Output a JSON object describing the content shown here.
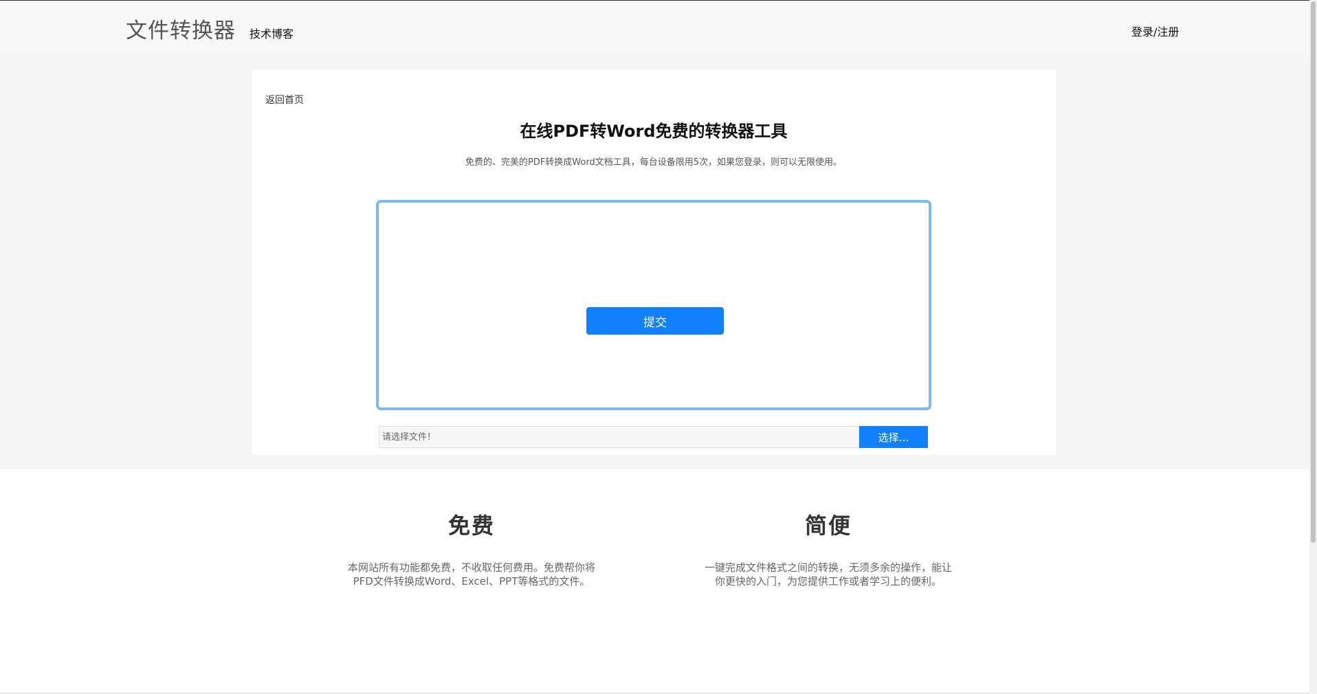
{
  "header": {
    "logo": "文件转换器",
    "nav_blog": "技术博客",
    "login": "登录/注册"
  },
  "converter": {
    "back_link": "返回首页",
    "title": "在线PDF转Word免费的转换器工具",
    "subtitle": "免费的、完美的PDF转换成Word文档工具，每台设备限用5次，如果您登录，则可以无限使用。",
    "submit_label": "提交",
    "file_placeholder": "请选择文件！",
    "choose_label": "选择…"
  },
  "features": [
    {
      "title": "免费",
      "desc": "本网站所有功能都免费，不收取任何费用。免费帮你将PFD文件转换成Word、Excel、PPT等格式的文件。"
    },
    {
      "title": "简便",
      "desc": "一键完成文件格式之间的转换，无须多余的操作，能让你更快的入门，为您提供工作或者学习上的便利。"
    }
  ],
  "colors": {
    "accent": "#1380fb",
    "dropzone_border": "#7fbaee",
    "header_bg": "#f8f8f8",
    "band_bg": "#f5f5f5"
  }
}
